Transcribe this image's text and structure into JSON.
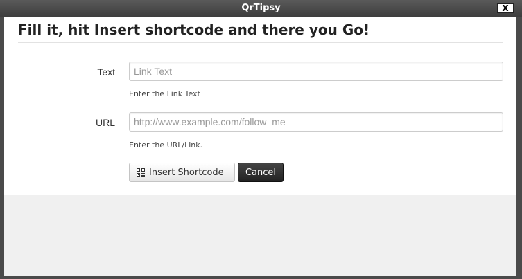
{
  "window": {
    "title": "QrTipsy",
    "close_label": "X"
  },
  "form": {
    "heading": "Fill it, hit Insert shortcode and there you Go!",
    "text_field": {
      "label": "Text",
      "placeholder": "Link Text",
      "value": "",
      "help": "Enter the Link Text"
    },
    "url_field": {
      "label": "URL",
      "placeholder": "http://www.example.com/follow_me",
      "value": "",
      "help": "Enter the URL/Link."
    },
    "buttons": {
      "insert_label": "Insert Shortcode",
      "insert_icon": "qr-code-icon",
      "cancel_label": "Cancel"
    }
  },
  "colors": {
    "titlebar": "#3d3d3d",
    "panel": "#ffffff",
    "lower_area": "#f0f0f0",
    "cancel_button": "#222222"
  }
}
